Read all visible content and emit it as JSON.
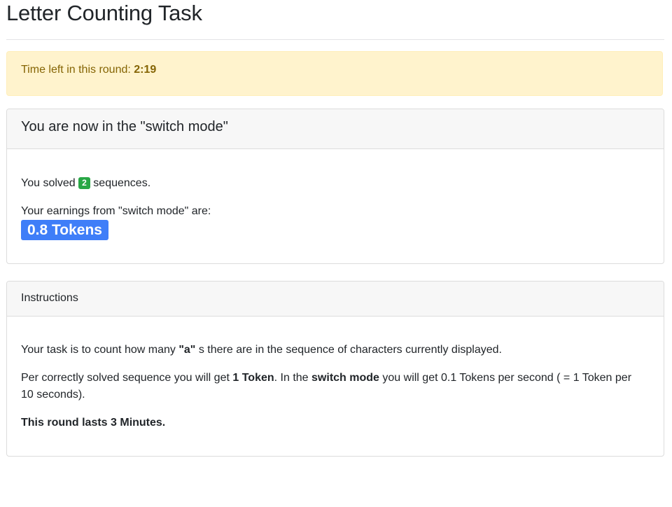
{
  "page": {
    "title": "Letter Counting Task"
  },
  "timer": {
    "label": "Time left in this round:",
    "value": "2:19"
  },
  "switch_card": {
    "header": "You are now in the \"switch mode\"",
    "solved_prefix": "You solved",
    "solved_count": "2",
    "solved_suffix": "sequences.",
    "earnings_label": "Your earnings from \"switch mode\" are:",
    "earnings_value": "0.8 Tokens",
    "accent_color": "#3f7ef8",
    "badge_color": "#28a745"
  },
  "instructions": {
    "header": "Instructions",
    "line1_prefix": "Your task is to count how many",
    "line1_letter": "\"a\"",
    "line1_suffix": "s there are in the sequence of characters currently displayed.",
    "line2_prefix": "Per correctly solved sequence you will get",
    "line2_reward": "1 Token",
    "line2_mid": ". In the",
    "line2_mode": "switch mode",
    "line2_rest": "you will get 0.1 Tokens per second ( = 1 Token per",
    "line2_cont": "10 seconds).",
    "line3": "This round lasts 3 Minutes."
  }
}
